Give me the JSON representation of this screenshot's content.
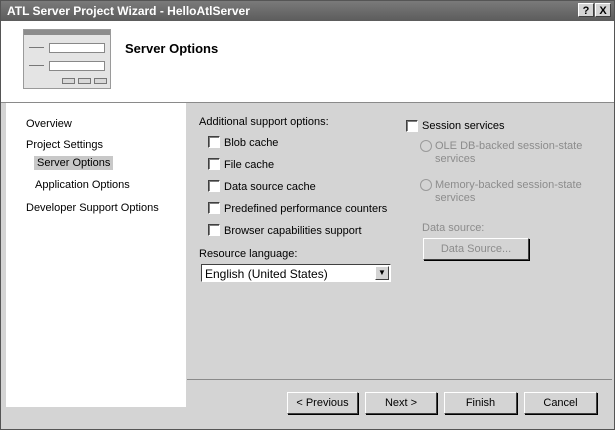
{
  "window": {
    "title": "ATL Server Project Wizard - HelloAtlServer",
    "help_label": "?",
    "close_label": "X"
  },
  "header": {
    "title": "Server Options"
  },
  "nav": {
    "items": [
      {
        "label": "Overview"
      },
      {
        "label": "Project Settings"
      },
      {
        "label": "Server Options"
      },
      {
        "label": "Application Options"
      },
      {
        "label": "Developer Support Options"
      }
    ]
  },
  "support": {
    "heading": "Additional support options:",
    "options": [
      {
        "label": "Blob cache",
        "checked": false
      },
      {
        "label": "File cache",
        "checked": false
      },
      {
        "label": "Data source cache",
        "checked": false
      },
      {
        "label": "Predefined performance counters",
        "checked": false
      },
      {
        "label": "Browser capabilities support",
        "checked": false
      }
    ]
  },
  "resource_language": {
    "label": "Resource language:",
    "value": "English (United States)"
  },
  "session": {
    "label": "Session services",
    "checked": false,
    "ole_line1": "OLE DB-backed session-state",
    "ole_line2": "services",
    "mem_line1": "Memory-backed session-state",
    "mem_line2": "services",
    "data_source_label": "Data source:",
    "data_source_button": "Data Source..."
  },
  "buttons": {
    "previous": "< Previous",
    "next": "Next >",
    "finish": "Finish",
    "cancel": "Cancel"
  }
}
